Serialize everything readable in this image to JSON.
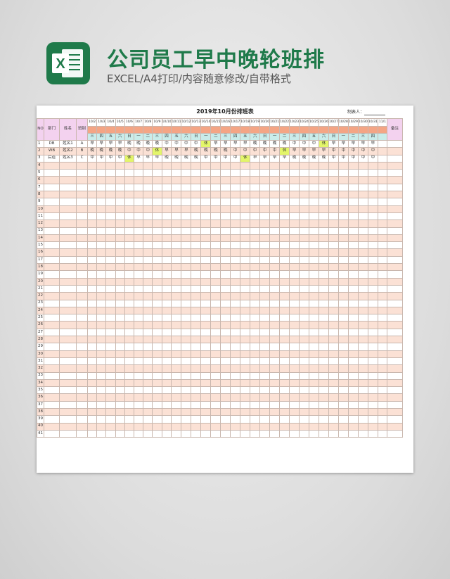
{
  "header": {
    "title": "公司员工早中晚轮班排",
    "subtitle": "EXCEL/A4打印/内容随意修改/自带格式"
  },
  "sheet": {
    "title": "2019年10月份排班表",
    "maker_label": "制表人：",
    "col_headers": {
      "no": "NO",
      "dept": "部门",
      "name": "姓名",
      "shift": "班别",
      "remark": "备注"
    },
    "dates": [
      "10/2",
      "10/3",
      "10/4",
      "10/5",
      "10/6",
      "10/7",
      "10/8",
      "10/9",
      "10/10",
      "10/11",
      "10/12",
      "10/13",
      "10/14",
      "10/15",
      "10/16",
      "10/17",
      "10/18",
      "10/19",
      "10/20",
      "10/21",
      "10/22",
      "10/23",
      "10/24",
      "10/25",
      "10/26",
      "10/27",
      "10/28",
      "10/29",
      "10/30",
      "10/31",
      "11/1"
    ],
    "weekdays": [
      "三",
      "四",
      "五",
      "六",
      "日",
      "一",
      "二",
      "三",
      "四",
      "五",
      "六",
      "日",
      "一",
      "二",
      "三",
      "四",
      "五",
      "六",
      "日",
      "一",
      "二",
      "三",
      "四",
      "五",
      "六",
      "日",
      "一",
      "二",
      "三",
      "四",
      ""
    ],
    "rows": [
      {
        "no": "1",
        "dept": "DB",
        "name": "姓名1",
        "shift": "A",
        "days": [
          "早",
          "早",
          "早",
          "早",
          "晚",
          "晚",
          "晚",
          "晚",
          "中",
          "中",
          "中",
          "中",
          "休",
          "早",
          "早",
          "早",
          "早",
          "晚",
          "晚",
          "晚",
          "晚",
          "中",
          "中",
          "中",
          "休",
          "早",
          "早",
          "早",
          "早",
          "早",
          ""
        ]
      },
      {
        "no": "2",
        "dept": "WB",
        "name": "姓名2",
        "shift": "B",
        "days": [
          "晚",
          "晚",
          "晚",
          "晚",
          "中",
          "中",
          "中",
          "休",
          "早",
          "早",
          "早",
          "晚",
          "晚",
          "晚",
          "晚",
          "中",
          "中",
          "中",
          "中",
          "中",
          "休",
          "早",
          "早",
          "早",
          "早",
          "中",
          "中",
          "中",
          "中",
          "中",
          ""
        ]
      },
      {
        "no": "3",
        "dept": "后道",
        "name": "姓名3",
        "shift": "C",
        "days": [
          "中",
          "中",
          "中",
          "中",
          "休",
          "早",
          "早",
          "早",
          "晚",
          "晚",
          "晚",
          "晚",
          "中",
          "中",
          "中",
          "中",
          "休",
          "早",
          "早",
          "早",
          "早",
          "晚",
          "晚",
          "晚",
          "晚",
          "中",
          "中",
          "中",
          "中",
          "中",
          ""
        ]
      }
    ],
    "empty_row_numbers": [
      "4",
      "5",
      "6",
      "7",
      "8",
      "9",
      "10",
      "11",
      "12",
      "13",
      "14",
      "15",
      "16",
      "17",
      "18",
      "19",
      "20",
      "21",
      "22",
      "23",
      "24",
      "25",
      "26",
      "27",
      "28",
      "29",
      "30",
      "31",
      "32",
      "33",
      "34",
      "35",
      "36",
      "37",
      "38",
      "39",
      "40",
      "41"
    ]
  }
}
